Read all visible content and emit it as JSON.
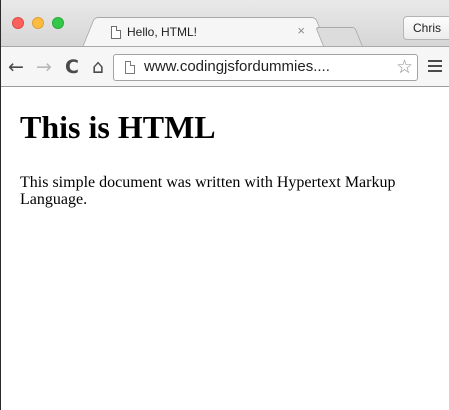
{
  "browser": {
    "tab": {
      "title": "Hello, HTML!",
      "close_glyph": "×",
      "icon": "page-icon"
    },
    "profile_name": "Chris",
    "address": {
      "url": "www.codingjsfordummies....",
      "icon": "page-icon"
    },
    "nav": {
      "back_glyph": "←",
      "forward_glyph": "→",
      "reload_glyph": "C",
      "home_glyph": "⌂",
      "star_glyph": "☆"
    }
  },
  "page": {
    "heading": "This is HTML",
    "paragraph": "This simple document was written with Hypertext Markup Language."
  },
  "colors": {
    "close": "#fc605c",
    "minimize": "#fdbc40",
    "maximize": "#34c84a"
  }
}
